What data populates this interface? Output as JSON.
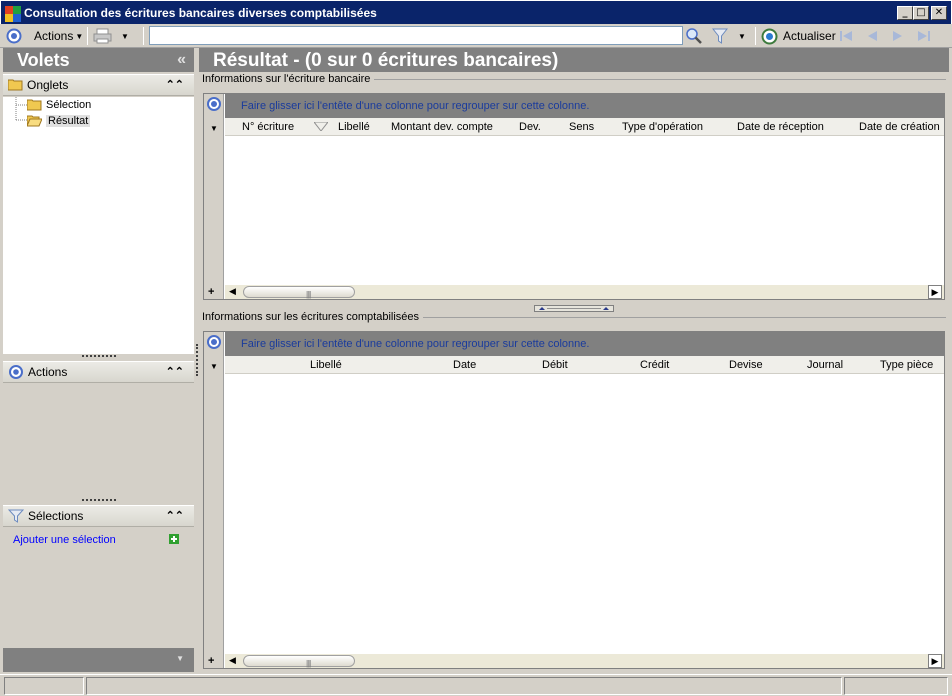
{
  "window": {
    "title": "Consultation des écritures bancaires diverses comptabilisées",
    "minimize": "_",
    "maximize": "□",
    "close": "✕"
  },
  "toolbar": {
    "actions_label": "Actions",
    "search_value": "",
    "refresh_label": "Actualiser"
  },
  "left": {
    "volets_title": "Volets",
    "collapse_glyph": "«",
    "onglets_label": "Onglets",
    "tree": [
      {
        "label": "Sélection"
      },
      {
        "label": "Résultat",
        "selected": true
      }
    ],
    "actions_label": "Actions",
    "selections_label": "Sélections",
    "add_selection_label": "Ajouter une sélection"
  },
  "right": {
    "result_title": "Résultat - (0 sur 0 écritures bancaires)",
    "top_section_title": "Informations sur l'écriture bancaire",
    "bottom_section_title": "Informations sur les écritures comptabilisées",
    "group_hint": "Faire glisser ici l'entête d'une colonne pour regrouper sur cette colonne.",
    "top_columns": [
      "N° écriture",
      "Libellé",
      "Montant dev. compte",
      "Dev.",
      "Sens",
      "Type d'opération",
      "Date de réception",
      "Date de création"
    ],
    "bottom_columns": [
      "Libellé",
      "Date",
      "Débit",
      "Crédit",
      "Devise",
      "Journal",
      "Type pièce"
    ]
  },
  "colors": {
    "title_bar": "#0a246a",
    "header_gray": "#808080",
    "accent_blue": "#4a6ec9"
  }
}
